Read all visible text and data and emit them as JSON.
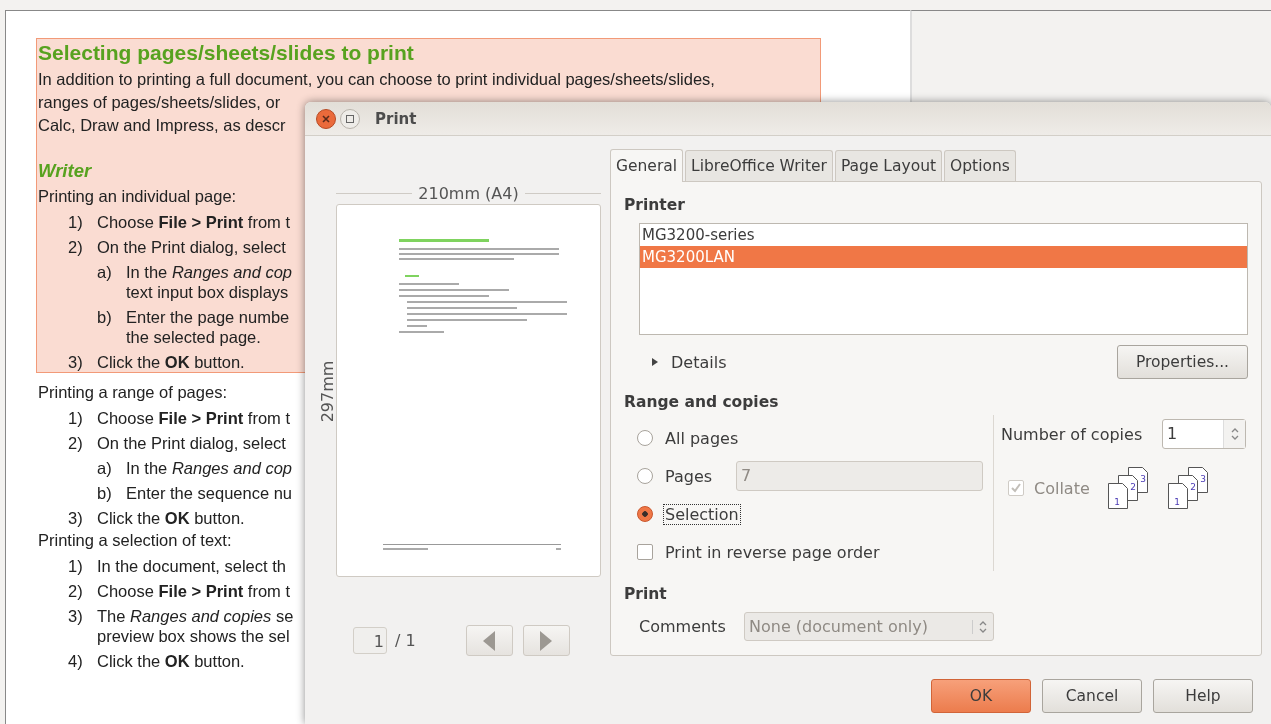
{
  "document": {
    "blocks": [
      {
        "selected": true,
        "lines": [
          {
            "kind": "heading",
            "text": "Selecting pages/sheets/slides to print"
          },
          {
            "kind": "para",
            "text": "In addition to printing a full document, you can choose to print individual pages/sheets/slides,"
          },
          {
            "kind": "para",
            "text": "ranges of pages/sheets/slides, or"
          },
          {
            "kind": "para",
            "text": "Calc, Draw and Impress, as descr"
          },
          {
            "kind": "subheading",
            "text": "Writer"
          },
          {
            "kind": "para",
            "text": "Printing an individual page:"
          },
          {
            "kind": "item",
            "num": "1)",
            "lines": [
              "Choose **File > Print** from t"
            ]
          },
          {
            "kind": "item",
            "num": "2)",
            "lines": [
              "On the Print dialog, select"
            ]
          },
          {
            "kind": "subitem",
            "num": "a)",
            "lines": [
              "In the *Ranges and cop*",
              "text input box displays"
            ]
          },
          {
            "kind": "subitem",
            "num": "b)",
            "lines": [
              "Enter the page numbe",
              "the selected page."
            ]
          },
          {
            "kind": "item",
            "num": "3)",
            "lines": [
              "Click the **OK** button."
            ]
          }
        ]
      },
      {
        "selected": false,
        "lines": [
          {
            "kind": "para",
            "text": "Printing a range of pages:"
          },
          {
            "kind": "item",
            "num": "1)",
            "lines": [
              "Choose **File > Print** from t"
            ]
          },
          {
            "kind": "item",
            "num": "2)",
            "lines": [
              "On the Print dialog, select"
            ]
          },
          {
            "kind": "subitem",
            "num": "a)",
            "lines": [
              "In the *Ranges and cop*"
            ]
          },
          {
            "kind": "subitem",
            "num": "b)",
            "lines": [
              "Enter the sequence nu"
            ]
          },
          {
            "kind": "item",
            "num": "3)",
            "lines": [
              "Click the **OK** button."
            ]
          },
          {
            "kind": "para",
            "text": "Printing a selection of text:"
          },
          {
            "kind": "item",
            "num": "1)",
            "lines": [
              "In the document, select th"
            ]
          },
          {
            "kind": "item",
            "num": "2)",
            "lines": [
              "Choose **File > Print** from t"
            ]
          },
          {
            "kind": "item",
            "num": "3)",
            "lines": [
              "The *Ranges and copies* se",
              "preview box shows the sel"
            ]
          },
          {
            "kind": "item",
            "num": "4)",
            "lines": [
              "Click the **OK** button."
            ]
          }
        ]
      }
    ]
  },
  "dialog": {
    "title": "Print",
    "preview": {
      "page_width": "210mm (A4)",
      "page_height": "297mm",
      "page_field": "1",
      "page_total": "/ 1"
    },
    "tabs": [
      {
        "label": "General",
        "selected": true
      },
      {
        "label": "LibreOffice Writer",
        "selected": false
      },
      {
        "label": "Page Layout",
        "selected": false
      },
      {
        "label": "Options",
        "selected": false
      }
    ],
    "printer": {
      "heading": "Printer",
      "items": [
        {
          "name": "MG3200-series",
          "selected": false
        },
        {
          "name": "MG3200LAN",
          "selected": true
        }
      ],
      "details": "Details",
      "expanded": false,
      "properties_button": "Properties..."
    },
    "range": {
      "heading": "Range and copies",
      "options": [
        {
          "kind": "radio",
          "label": "All pages",
          "selected": false,
          "focused": false
        },
        {
          "kind": "radio",
          "label": "Pages",
          "selected": false,
          "focused": false,
          "field": "7",
          "field_disabled": true
        },
        {
          "kind": "radio",
          "label": "Selection",
          "selected": true,
          "focused": true
        },
        {
          "kind": "checkbox",
          "label": "Print in reverse page order",
          "checked": false
        }
      ],
      "copies_label": "Number of copies",
      "copies": "1",
      "collate": {
        "label": "Collate",
        "checked": true,
        "disabled": true
      },
      "collate_icons": [
        {
          "pages": [
            "1",
            "2",
            "3"
          ]
        },
        {
          "pages": [
            "1",
            "2",
            "3"
          ]
        }
      ]
    },
    "print": {
      "heading": "Print",
      "comments_label": "Comments",
      "comments": "None (document only)",
      "comments_disabled": true
    },
    "buttons": [
      {
        "label": "OK",
        "default": true
      },
      {
        "label": "Cancel",
        "default": false
      },
      {
        "label": "Help",
        "default": false
      }
    ]
  }
}
